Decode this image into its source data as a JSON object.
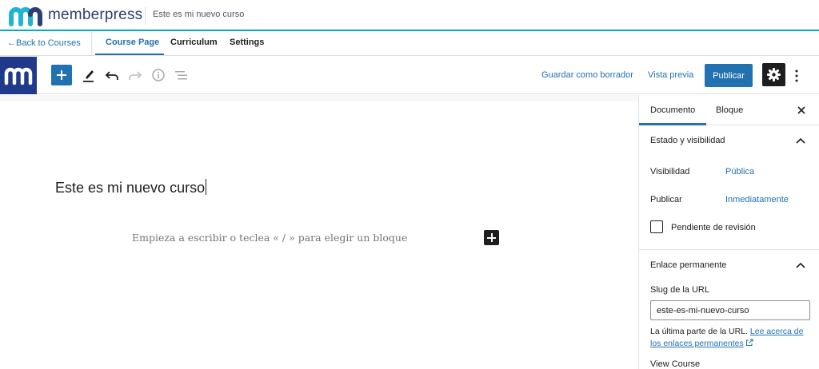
{
  "brand": {
    "name": "memberpress",
    "course_title": "Este es mi nuevo curso",
    "colors": {
      "accent": "#06a9c8",
      "brand_text": "#2c3e73",
      "primary": "#2271b1"
    }
  },
  "course_nav": {
    "back_label": "←Back to Courses",
    "tabs": [
      {
        "label": "Course Page",
        "active": true
      },
      {
        "label": "Curriculum",
        "active": false
      },
      {
        "label": "Settings",
        "active": false
      }
    ]
  },
  "toolbar": {
    "icons": [
      "plus-icon",
      "pencil-icon",
      "undo-icon",
      "redo-icon",
      "info-icon",
      "list-view-icon"
    ],
    "save_draft_label": "Guardar como borrador",
    "preview_label": "Vista previa",
    "publish_label": "Publicar"
  },
  "editor": {
    "post_title": "Este es mi nuevo curso",
    "block_placeholder": "Empieza a escribir o teclea « / » para elegir un bloque"
  },
  "sidebar": {
    "tabs": [
      {
        "label": "Documento",
        "active": true
      },
      {
        "label": "Bloque",
        "active": false
      }
    ],
    "status_panel": {
      "title": "Estado y visibilidad",
      "visibility_label": "Visibilidad",
      "visibility_value": "Pública",
      "publish_label": "Publicar",
      "publish_value": "Inmediatamente",
      "pending_review_label": "Pendiente de revisión",
      "pending_review_checked": false
    },
    "permalink_panel": {
      "title": "Enlace permanente",
      "slug_label": "Slug de la URL",
      "slug_value": "este-es-mi-nuevo-curso",
      "help_text": "La última parte de la URL.",
      "help_link": "Lee acerca de los enlaces permanentes",
      "view_label": "View Course"
    }
  }
}
